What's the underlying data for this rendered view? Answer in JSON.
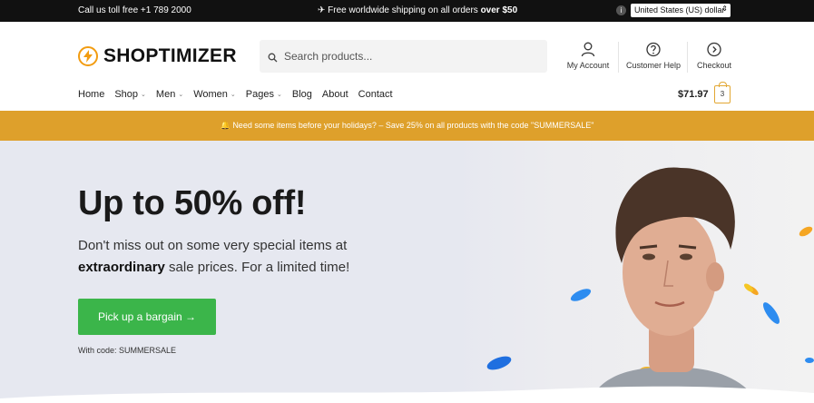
{
  "topbar": {
    "call": "Call us toll free +1 789 2000",
    "shipping_prefix": "✈ Free worldwide shipping on all orders ",
    "shipping_bold": "over $50",
    "currency": "United States (US) dollar"
  },
  "header": {
    "logo_text": "SHOPTIMIZER",
    "search_placeholder": "Search products...",
    "links": [
      {
        "label": "My Account",
        "icon": "user-icon"
      },
      {
        "label": "Customer Help",
        "icon": "help-icon"
      },
      {
        "label": "Checkout",
        "icon": "arrow-right-circle-icon"
      }
    ]
  },
  "nav": {
    "items": [
      {
        "label": "Home"
      },
      {
        "label": "Shop"
      },
      {
        "label": "Men"
      },
      {
        "label": "Women"
      },
      {
        "label": "Pages"
      },
      {
        "label": "Blog"
      },
      {
        "label": "About"
      },
      {
        "label": "Contact"
      }
    ],
    "cart_total": "$71.97",
    "cart_count": "3"
  },
  "promo": {
    "text": "Need some items before your holidays? – Save 25% on all products with the code \"SUMMERSALE\""
  },
  "hero": {
    "title": "Up to 50% off!",
    "sub_line1": "Don't miss out on some very special items at",
    "sub_bold": "extraordinary",
    "sub_line2": " sale prices. For a limited time!",
    "cta": "Pick up a bargain →",
    "code_note": "With code: SUMMERSALE"
  },
  "colors": {
    "accent": "#dea02b",
    "cta": "#3bb54a",
    "logo": "#f29c11"
  }
}
